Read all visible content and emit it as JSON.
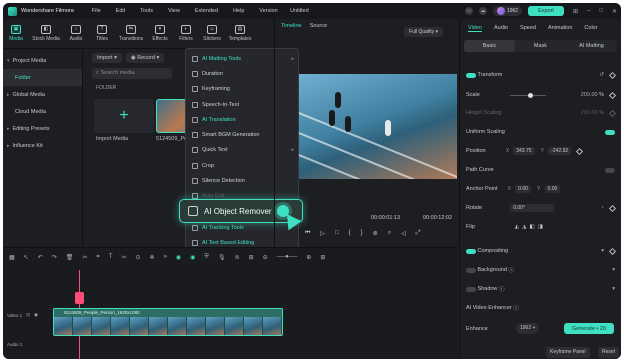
{
  "titlebar": {
    "app_name": "Wondershare Filmora",
    "menu": [
      "File",
      "Edit",
      "Tools",
      "View",
      "Extended",
      "Help",
      "Version"
    ],
    "project_title": "Untitled",
    "credits": "1962",
    "export_label": "Export"
  },
  "toolbar": {
    "items": [
      {
        "label": "Media",
        "icon": "media-icon"
      },
      {
        "label": "Stock Media",
        "icon": "stock-media-icon"
      },
      {
        "label": "Audio",
        "icon": "audio-icon"
      },
      {
        "label": "Titles",
        "icon": "titles-icon"
      },
      {
        "label": "Transitions",
        "icon": "transitions-icon"
      },
      {
        "label": "Effects",
        "icon": "effects-icon"
      },
      {
        "label": "Filters",
        "icon": "filters-icon"
      },
      {
        "label": "Stickers",
        "icon": "stickers-icon"
      },
      {
        "label": "Templates",
        "icon": "templates-icon"
      }
    ]
  },
  "sidebar": {
    "items": [
      {
        "label": "Project Media"
      },
      {
        "label": "Folder"
      },
      {
        "label": "Global Media"
      },
      {
        "label": "Cloud Media"
      },
      {
        "label": "Editing Presets"
      },
      {
        "label": "Influence Kit"
      }
    ]
  },
  "media": {
    "import_label": "Import",
    "record_label": "Record",
    "search_placeholder": "Search media",
    "folder_label": "FOLDER",
    "import_media_label": "Import Media",
    "thumb_label": "5124509_Pe..."
  },
  "context_menu": {
    "items": [
      "AI Matting Tools",
      "Duration",
      "Keyframing",
      "Speech-to-Text",
      "AI Translation",
      "Smart BGM Generation",
      "Quick Text",
      "Crop",
      "Silence Detection",
      "Auto Edit",
      "AI Object Remover",
      "AI Tracking Tools",
      "AI Text Based Editing"
    ],
    "highlight": "AI Object Remover"
  },
  "player": {
    "tab_timeline": "Timeline",
    "tab_source": "Source",
    "quality": "Full Quality",
    "current_time": "00:00:01:13",
    "total_time": "00:00:12:02"
  },
  "props": {
    "tabs": [
      "Video",
      "Audio",
      "Speed",
      "Animation",
      "Color"
    ],
    "subtabs": [
      "Basic",
      "Mask",
      "AI Matting"
    ],
    "transform": "Transform",
    "scale": "Scale",
    "scale_value": "200.00",
    "height_scaling": "Height Scaling",
    "height_value": "200.00",
    "uniform_scaling": "Uniform Scaling",
    "position": "Position",
    "pos_x": "343.75",
    "pos_y": "-242.92",
    "path_curve": "Path Curve",
    "anchor_point": "Anchor Point",
    "anchor_x": "0.00",
    "anchor_y": "0.00",
    "rotate": "Rotate",
    "rotate_value": "0.00°",
    "flip": "Flip",
    "compositing": "Compositing",
    "background": "Background",
    "shadow": "Shadow",
    "ai_enhancer": "AI Video Enhancer",
    "enhance": "Enhance",
    "enhance_credits": "1962",
    "generate": "Generate",
    "generate_cost": "20",
    "keyframe_panel": "Keyframe Panel",
    "reset": "Reset"
  },
  "timeline": {
    "track_video": "Video 1",
    "track_audio": "Audio 1",
    "clip_label": "5124509_People_Person_1920x1080",
    "playhead_color": "#ff4d7a",
    "accent": "#3fe0c2"
  }
}
